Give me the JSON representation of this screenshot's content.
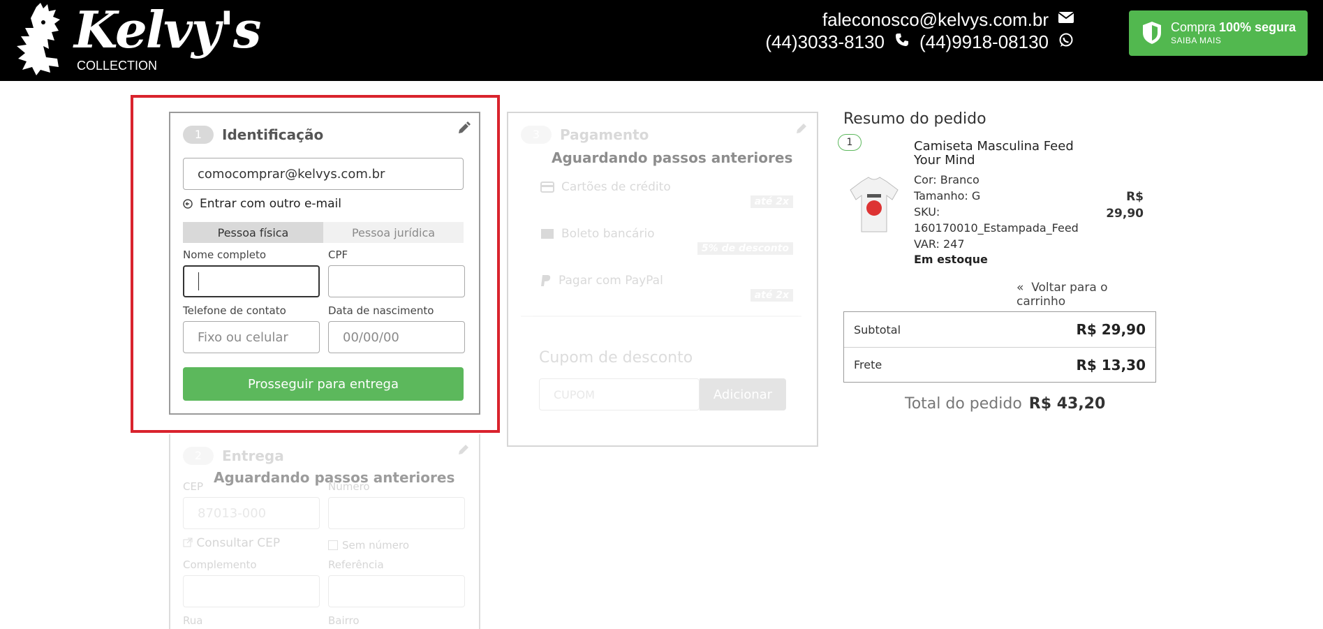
{
  "header": {
    "brand": "Kelvy's",
    "brand_sub": "COLLECTION",
    "email": "faleconosco@kelvys.com.br",
    "phone": "(44)3033-8130",
    "whatsapp": "(44)9918-08130",
    "secure_prefix": "Compra",
    "secure_bold": "100% segura",
    "secure_sub": "SAIBA MAIS",
    "secure_color": "#52b84f"
  },
  "step1": {
    "number": "1",
    "title": "Identificação",
    "email_value": "comocomprar@kelvys.com.br",
    "change_email": "Entrar com outro e-mail",
    "tabs": [
      "Pessoa física",
      "Pessoa jurídica"
    ],
    "label_name": "Nome completo",
    "label_cpf": "CPF",
    "label_phone": "Telefone de contato",
    "phone_placeholder": "Fixo ou celular",
    "label_birth": "Data de nascimento",
    "birth_placeholder": "00/00/00",
    "submit": "Prosseguir para entrega",
    "accent": "#5cb85c"
  },
  "step2": {
    "number": "2",
    "title": "Entrega",
    "waiting": "Aguardando passos anteriores",
    "label_cep": "CEP",
    "cep_placeholder": "87013-000",
    "label_numero": "Número",
    "consult_cep": "Consultar CEP",
    "sem_numero": "Sem número",
    "label_complemento": "Complemento",
    "label_referencia": "Referência",
    "label_rua": "Rua",
    "label_bairro": "Bairro"
  },
  "step3": {
    "number": "3",
    "title": "Pagamento",
    "waiting": "Aguardando passos anteriores",
    "options": [
      {
        "label": "Cartões de crédito",
        "badge": "até 2x"
      },
      {
        "label": "Boleto bancário",
        "badge": "5% de desconto"
      },
      {
        "label": "Pagar com PayPal",
        "badge": "até 2x"
      }
    ],
    "coupon_title": "Cupom de desconto",
    "coupon_placeholder": "CUPOM",
    "coupon_button": "Adicionar"
  },
  "summary": {
    "title": "Resumo do pedido",
    "qty": "1",
    "product_name": "Camiseta Masculina Feed Your Mind",
    "color": "Cor: Branco",
    "size": "Tamanho: G",
    "sku_label": "SKU:",
    "sku": "160170010_Estampada_Feed",
    "var": "VAR: 247",
    "stock": "Em estoque",
    "price_currency": "R$",
    "price_value": "29,90",
    "back": "Voltar para o carrinho",
    "subtotal_label": "Subtotal",
    "subtotal_value": "R$ 29,90",
    "freight_label": "Frete",
    "freight_value": "R$ 13,30",
    "total_label": "Total do pedido",
    "total_value": "R$ 43,20"
  }
}
